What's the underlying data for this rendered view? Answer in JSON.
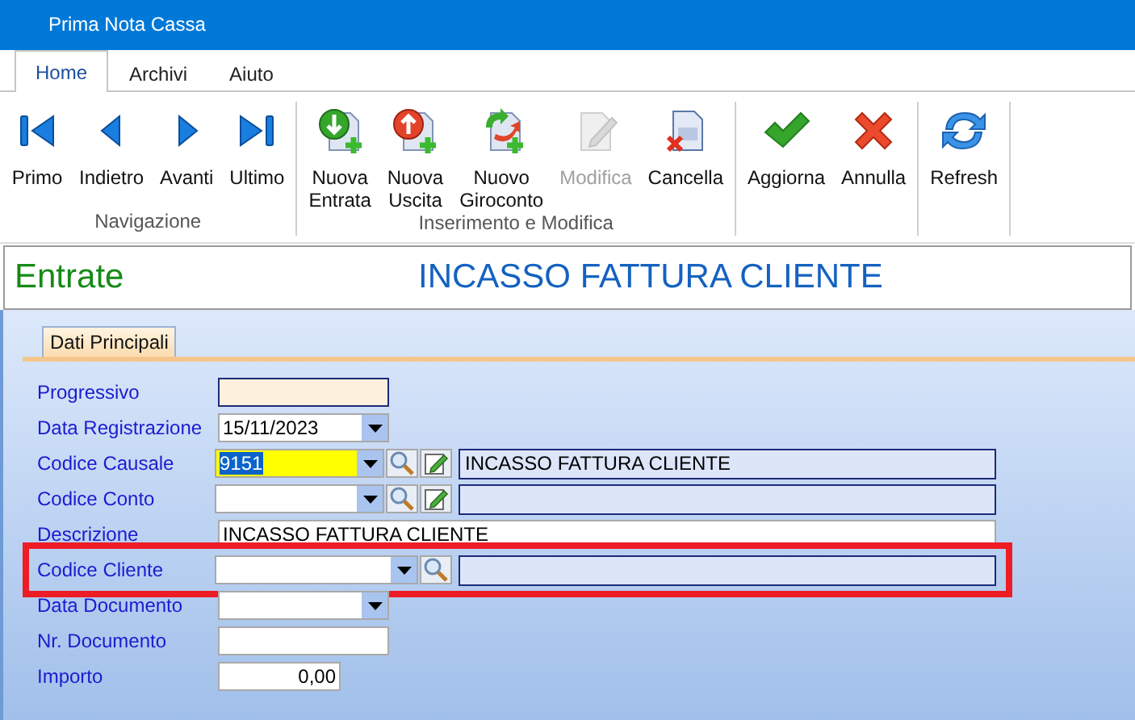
{
  "window": {
    "title": "Prima Nota Cassa"
  },
  "ribbon_tabs": [
    {
      "label": "Home",
      "selected": true
    },
    {
      "label": "Archivi",
      "selected": false
    },
    {
      "label": "Aiuto",
      "selected": false
    }
  ],
  "ribbon_groups": [
    {
      "label": "Navigazione",
      "buttons": [
        {
          "label": "Primo",
          "kind": "first",
          "disabled": false
        },
        {
          "label": "Indietro",
          "kind": "prev",
          "disabled": false
        },
        {
          "label": "Avanti",
          "kind": "next",
          "disabled": false
        },
        {
          "label": "Ultimo",
          "kind": "last",
          "disabled": false
        }
      ]
    },
    {
      "label": "Inserimento e Modifica",
      "buttons": [
        {
          "label": "Nuova\nEntrata",
          "kind": "new-in",
          "disabled": false
        },
        {
          "label": "Nuova\nUscita",
          "kind": "new-out",
          "disabled": false
        },
        {
          "label": "Nuovo\nGiroconto",
          "kind": "transfer",
          "disabled": false
        },
        {
          "label": "Modifica",
          "kind": "edit",
          "disabled": true
        },
        {
          "label": "Cancella",
          "kind": "delete",
          "disabled": false
        }
      ]
    },
    {
      "buttons": [
        {
          "label": "Aggiorna",
          "kind": "confirm",
          "disabled": false
        },
        {
          "label": "Annulla",
          "kind": "cancel",
          "disabled": false
        }
      ]
    },
    {
      "buttons": [
        {
          "label": "Refresh",
          "kind": "refresh",
          "disabled": false
        }
      ]
    }
  ],
  "header": {
    "section": "Entrate",
    "title": "INCASSO FATTURA CLIENTE"
  },
  "form": {
    "tabs": [
      {
        "label": "Dati Principali",
        "selected": true
      }
    ],
    "fields": [
      {
        "label": "Progressivo",
        "kind": "readonly"
      },
      {
        "label": "Data Registrazione",
        "kind": "date",
        "value": "15/11/2023"
      },
      {
        "label": "Codice Causale",
        "kind": "lookup",
        "value": "9151",
        "focused": true,
        "editable": true,
        "highlighted": false,
        "description": "INCASSO FATTURA CLIENTE"
      },
      {
        "label": "Codice Conto",
        "kind": "lookup",
        "focused": false,
        "editable": true,
        "highlighted": false
      },
      {
        "label": "Descrizione",
        "kind": "wide",
        "value": "INCASSO FATTURA CLIENTE"
      },
      {
        "label": "Codice Cliente",
        "kind": "lookup",
        "focused": false,
        "editable": false,
        "highlighted": true
      },
      {
        "label": "Data Documento",
        "kind": "date"
      },
      {
        "label": "Nr. Documento",
        "kind": "text"
      },
      {
        "label": "Importo",
        "kind": "amount",
        "value": "0,00"
      }
    ]
  }
}
